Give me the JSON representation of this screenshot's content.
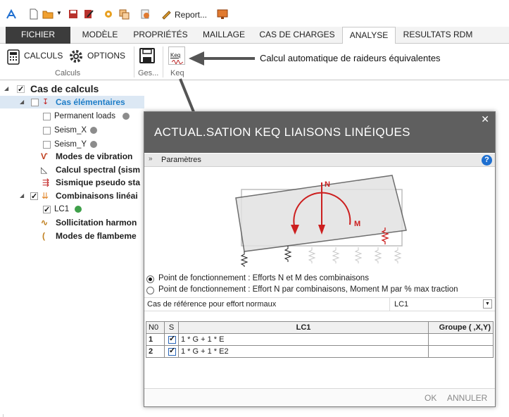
{
  "quick_access": {
    "report_label": "Report..."
  },
  "tabs": [
    {
      "label": "FICHIER"
    },
    {
      "label": "MODÈLE"
    },
    {
      "label": "PROPRIÉTÉS"
    },
    {
      "label": "MAILLAGE"
    },
    {
      "label": "CAS DE CHARGES"
    },
    {
      "label": "ANALYSE"
    },
    {
      "label": "RESULTATS RDM"
    }
  ],
  "ribbon": {
    "calculs_label": "CALCULS",
    "options_label": "OPTIONS",
    "group_calculs": "Calculs",
    "group_ges": "Ges...",
    "group_keq": "Keq",
    "keq_icon_text": "Keq"
  },
  "callout": "Calcul automatique de raideurs équivalentes",
  "tree": {
    "root": "Cas de calculs",
    "elementary": "Cas élémentaires",
    "items": [
      "Permanent loads",
      "Seism_X",
      "Seism_Y"
    ],
    "modes_vibration": "Modes de vibration",
    "calcul_spectral": "Calcul spectral (sism",
    "sismique_pseudo": "Sismique pseudo sta",
    "combinaisons": "Combinaisons linéai",
    "lc1": "LC1",
    "sollicitation": "Sollicitation harmon",
    "flambement": "Modes de flambeme"
  },
  "dialog": {
    "title": "ACTUAL.SATION KEQ LIAISONS LINÉIQUES",
    "params_label": "Paramètres",
    "diagram_labels": {
      "n": "N",
      "m": "M"
    },
    "radio1": "Point de fonctionnement : Efforts N et M des combinaisons",
    "radio2": "Point de fonctionnement : Effort N par combinaisons, Moment M par % max traction",
    "ref_label": "Cas de référence pour effort normaux",
    "ref_value": "LC1",
    "table": {
      "headers": [
        "N0",
        "S",
        "LC1",
        "Groupe ( ,X,Y)"
      ],
      "rows": [
        {
          "no": "1",
          "formula": "1 * G + 1 * E",
          "group": ""
        },
        {
          "no": "2",
          "formula": "1 * G + 1 * E2",
          "group": ""
        }
      ]
    },
    "ok_label": "OK",
    "cancel_label": "ANNULER"
  },
  "colors": {
    "accent_blue": "#1f7ec8",
    "dialog_header": "#5f5f5f",
    "moment_red": "#cc1f1f"
  }
}
